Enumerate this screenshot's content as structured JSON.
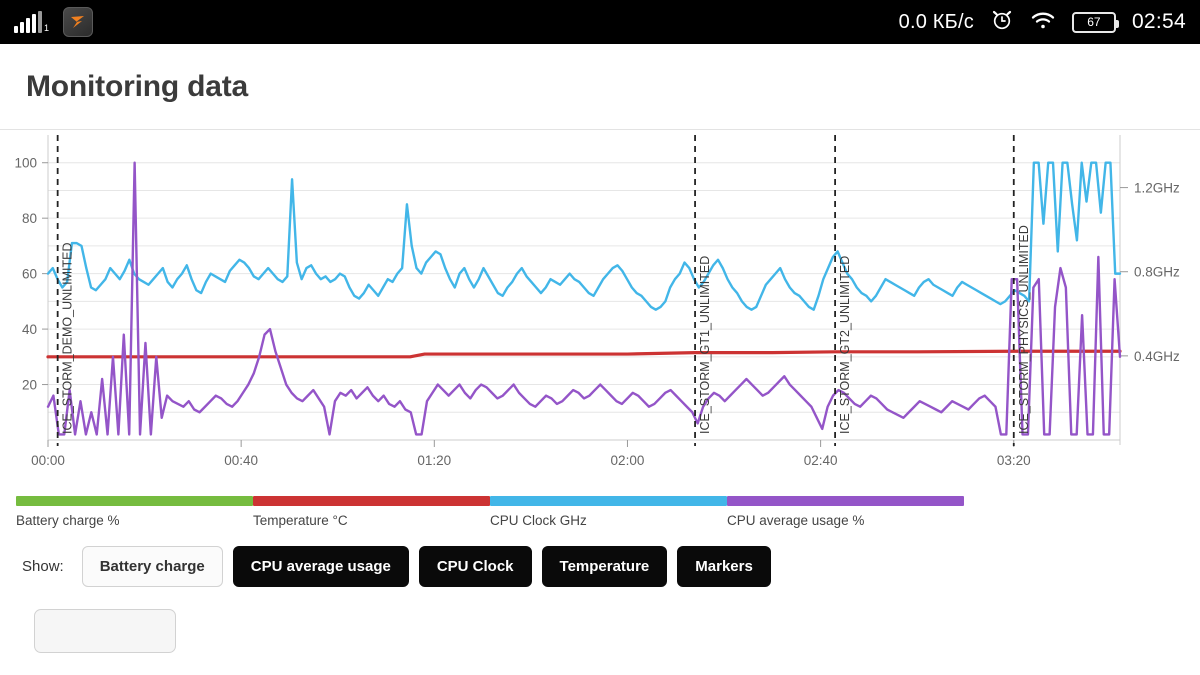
{
  "statusbar": {
    "signal_icon": "signal-bars-icon",
    "signal_sub": "1",
    "app_icon": "orange-bird-app-icon",
    "network_speed": "0.0 КБ/с",
    "alarm_icon": "alarm-clock-icon",
    "wifi_icon": "wifi-icon",
    "battery_icon": "battery-icon",
    "battery_level": "67",
    "time": "02:54"
  },
  "header": {
    "title": "Monitoring data"
  },
  "legend": [
    {
      "label": "Battery charge %",
      "color": "#76bc3f"
    },
    {
      "label": "Temperature °C",
      "color": "#cc3333"
    },
    {
      "label": "CPU Clock GHz",
      "color": "#42b6e8"
    },
    {
      "label": "CPU average usage %",
      "color": "#9455c8"
    }
  ],
  "controls": {
    "show_label": "Show:",
    "buttons": [
      {
        "label": "Battery charge",
        "active": false
      },
      {
        "label": "CPU average usage",
        "active": true
      },
      {
        "label": "CPU Clock",
        "active": true
      },
      {
        "label": "Temperature",
        "active": true
      },
      {
        "label": "Markers",
        "active": true
      }
    ]
  },
  "chart_data": {
    "type": "line",
    "title": "Monitoring data",
    "xlabel": "",
    "ylabel": "",
    "grid": true,
    "legend_position": "bottom",
    "x_ticks": [
      "00:00",
      "00:40",
      "01:20",
      "02:00",
      "02:40",
      "03:20"
    ],
    "x_tick_values": [
      0,
      40,
      80,
      120,
      160,
      200
    ],
    "xlim": [
      0,
      222
    ],
    "left_axis": {
      "ticks": [
        20,
        40,
        60,
        80,
        100
      ],
      "tick_labels": [
        "20",
        "40",
        "60",
        "80",
        "100"
      ],
      "ylim": [
        0,
        110
      ],
      "unit": "%"
    },
    "right_axis": {
      "ticks": [
        0.4,
        0.8,
        1.2
      ],
      "tick_labels": [
        "0.4GHz",
        "0.8GHz",
        "1.2GHz"
      ],
      "ylim": [
        0,
        1.45
      ],
      "unit": "GHz"
    },
    "markers": [
      {
        "label": "ICE_STORM_DEMO_UNLIMITED",
        "x": 2
      },
      {
        "label": "ICE_STORM_GT1_UNLIMITED",
        "x": 134
      },
      {
        "label": "ICE_STORM_GT2_UNLIMITED",
        "x": 163
      },
      {
        "label": "ICE_STORM_PHYSICS_UNLIMITED",
        "x": 200
      }
    ],
    "series": [
      {
        "name": "Battery charge %",
        "color": "#76bc3f",
        "visible": false,
        "axis": "left",
        "values": []
      },
      {
        "name": "Temperature °C",
        "color": "#cc3333",
        "visible": true,
        "axis": "left",
        "x": [
          0,
          20,
          40,
          60,
          75,
          78,
          100,
          120,
          134,
          150,
          163,
          180,
          200,
          215,
          222
        ],
        "values": [
          30,
          30,
          30,
          30,
          30,
          31,
          31,
          31,
          31.5,
          31.5,
          31.8,
          31.8,
          32,
          32,
          32
        ]
      },
      {
        "name": "CPU Clock GHz",
        "color": "#42b6e8",
        "visible": true,
        "axis": "left",
        "note": "plotted on 0-100 scale corresponding to right GHz axis",
        "values": [
          60,
          62,
          58,
          55,
          57,
          71,
          71,
          70,
          62,
          55,
          54,
          56,
          58,
          62,
          60,
          58,
          61,
          65,
          60,
          58,
          57,
          56,
          58,
          60,
          62,
          57,
          55,
          58,
          60,
          63,
          58,
          54,
          53,
          57,
          60,
          59,
          58,
          57,
          61,
          63,
          65,
          64,
          62,
          59,
          58,
          60,
          62,
          60,
          58,
          57,
          59,
          94,
          64,
          58,
          62,
          63,
          60,
          58,
          59,
          57,
          58,
          60,
          59,
          55,
          52,
          51,
          53,
          56,
          54,
          52,
          55,
          58,
          57,
          60,
          62,
          85,
          70,
          62,
          60,
          64,
          66,
          68,
          67,
          62,
          58,
          55,
          60,
          62,
          58,
          55,
          58,
          62,
          59,
          56,
          53,
          52,
          55,
          57,
          60,
          62,
          59,
          57,
          55,
          53,
          55,
          58,
          57,
          56,
          58,
          60,
          58,
          57,
          55,
          53,
          52,
          55,
          58,
          60,
          62,
          63,
          61,
          58,
          55,
          53,
          52,
          50,
          48,
          47,
          48,
          50,
          55,
          58,
          60,
          64,
          62,
          58,
          55,
          57,
          60,
          63,
          65,
          62,
          58,
          55,
          53,
          50,
          48,
          47,
          48,
          52,
          56,
          58,
          60,
          62,
          58,
          55,
          53,
          52,
          50,
          48,
          47,
          52,
          58,
          62,
          66,
          68,
          64,
          60,
          58,
          55,
          53,
          52,
          50,
          52,
          55,
          58,
          57,
          56,
          55,
          54,
          53,
          52,
          55,
          57,
          58,
          56,
          55,
          54,
          53,
          52,
          55,
          57,
          56,
          55,
          54,
          53,
          52,
          51,
          50,
          49,
          50,
          52,
          54,
          53,
          52,
          50,
          100,
          100,
          78,
          100,
          100,
          68,
          100,
          100,
          85,
          72,
          100,
          86,
          100,
          100,
          82,
          100,
          100,
          60,
          60
        ]
      },
      {
        "name": "CPU average usage %",
        "color": "#9455c8",
        "visible": true,
        "axis": "left",
        "values": [
          12,
          16,
          2,
          2,
          18,
          2,
          14,
          2,
          10,
          2,
          22,
          2,
          30,
          2,
          38,
          2,
          100,
          2,
          35,
          2,
          30,
          8,
          16,
          14,
          13,
          12,
          14,
          11,
          10,
          12,
          14,
          16,
          15,
          13,
          12,
          14,
          17,
          20,
          24,
          30,
          38,
          40,
          32,
          26,
          20,
          17,
          15,
          14,
          16,
          18,
          15,
          12,
          2,
          14,
          17,
          16,
          18,
          15,
          17,
          19,
          16,
          14,
          16,
          13,
          12,
          14,
          11,
          10,
          2,
          2,
          14,
          17,
          20,
          18,
          16,
          18,
          20,
          17,
          15,
          18,
          20,
          19,
          17,
          15,
          16,
          18,
          20,
          17,
          15,
          13,
          12,
          14,
          16,
          15,
          13,
          14,
          16,
          18,
          17,
          15,
          16,
          18,
          20,
          18,
          16,
          14,
          13,
          15,
          17,
          16,
          14,
          12,
          13,
          15,
          17,
          18,
          16,
          14,
          12,
          10,
          6,
          12,
          15,
          17,
          16,
          14,
          16,
          18,
          20,
          22,
          20,
          18,
          16,
          17,
          19,
          21,
          23,
          20,
          18,
          16,
          14,
          12,
          8,
          4,
          12,
          16,
          18,
          17,
          15,
          13,
          12,
          14,
          16,
          15,
          13,
          11,
          10,
          9,
          8,
          10,
          12,
          14,
          13,
          12,
          11,
          10,
          12,
          14,
          13,
          12,
          11,
          13,
          15,
          16,
          14,
          12,
          2,
          2,
          58,
          58,
          2,
          2,
          55,
          58,
          2,
          2,
          48,
          62,
          55,
          2,
          2,
          45,
          2,
          2,
          66,
          2,
          2,
          58,
          30
        ]
      }
    ]
  }
}
